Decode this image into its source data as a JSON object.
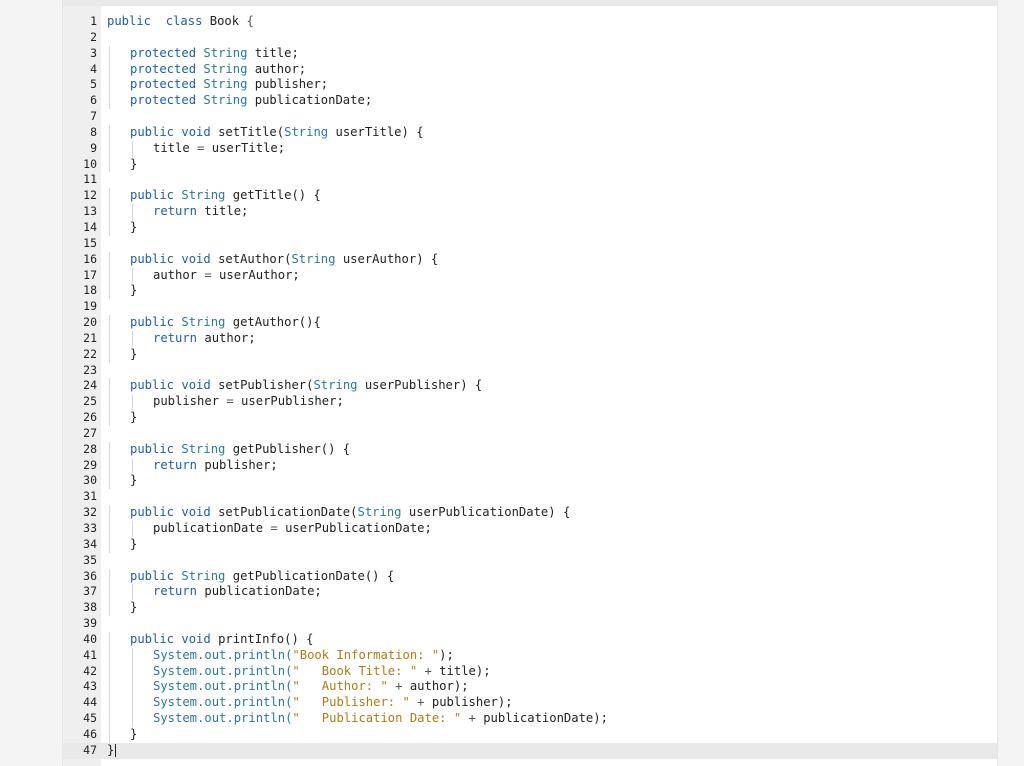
{
  "editor": {
    "lines": [
      {
        "n": "1",
        "t": [
          [
            "kw",
            "public"
          ],
          [
            "",
            "  "
          ],
          [
            "kw",
            "class"
          ],
          [
            "",
            " Book "
          ],
          [
            "op",
            "{"
          ]
        ],
        "i": 0
      },
      {
        "n": "2",
        "t": [],
        "i": 0
      },
      {
        "n": "3",
        "t": [
          [
            "kw",
            "protected"
          ],
          [
            "",
            " "
          ],
          [
            "tp",
            "String"
          ],
          [
            "",
            " title;"
          ]
        ],
        "i": 1
      },
      {
        "n": "4",
        "t": [
          [
            "kw",
            "protected"
          ],
          [
            "",
            " "
          ],
          [
            "tp",
            "String"
          ],
          [
            "",
            " author;"
          ]
        ],
        "i": 1
      },
      {
        "n": "5",
        "t": [
          [
            "kw",
            "protected"
          ],
          [
            "",
            " "
          ],
          [
            "tp",
            "String"
          ],
          [
            "",
            " publisher;"
          ]
        ],
        "i": 1
      },
      {
        "n": "6",
        "t": [
          [
            "kw",
            "protected"
          ],
          [
            "",
            " "
          ],
          [
            "tp",
            "String"
          ],
          [
            "",
            " publicationDate;"
          ]
        ],
        "i": 1
      },
      {
        "n": "7",
        "t": [],
        "i": 0
      },
      {
        "n": "8",
        "t": [
          [
            "kw",
            "public"
          ],
          [
            "",
            " "
          ],
          [
            "kw",
            "void"
          ],
          [
            "",
            " setTitle("
          ],
          [
            "tp",
            "String"
          ],
          [
            "",
            " userTitle) {"
          ]
        ],
        "i": 1
      },
      {
        "n": "9",
        "t": [
          [
            "",
            "title "
          ],
          [
            "op",
            "="
          ],
          [
            "",
            " userTitle;"
          ]
        ],
        "i": 2
      },
      {
        "n": "10",
        "t": [
          [
            "",
            "}"
          ]
        ],
        "i": 1
      },
      {
        "n": "11",
        "t": [],
        "i": 0
      },
      {
        "n": "12",
        "t": [
          [
            "kw",
            "public"
          ],
          [
            "",
            " "
          ],
          [
            "tp",
            "String"
          ],
          [
            "",
            " getTitle() {"
          ]
        ],
        "i": 1
      },
      {
        "n": "13",
        "t": [
          [
            "kw",
            "return"
          ],
          [
            "",
            " title;"
          ]
        ],
        "i": 2
      },
      {
        "n": "14",
        "t": [
          [
            "",
            "}"
          ]
        ],
        "i": 1
      },
      {
        "n": "15",
        "t": [],
        "i": 0
      },
      {
        "n": "16",
        "t": [
          [
            "kw",
            "public"
          ],
          [
            "",
            " "
          ],
          [
            "kw",
            "void"
          ],
          [
            "",
            " setAuthor("
          ],
          [
            "tp",
            "String"
          ],
          [
            "",
            " userAuthor) {"
          ]
        ],
        "i": 1
      },
      {
        "n": "17",
        "t": [
          [
            "",
            "author "
          ],
          [
            "op",
            "="
          ],
          [
            "",
            " userAuthor;"
          ]
        ],
        "i": 2
      },
      {
        "n": "18",
        "t": [
          [
            "",
            "}"
          ]
        ],
        "i": 1
      },
      {
        "n": "19",
        "t": [],
        "i": 0
      },
      {
        "n": "20",
        "t": [
          [
            "kw",
            "public"
          ],
          [
            "",
            " "
          ],
          [
            "tp",
            "String"
          ],
          [
            "",
            " getAuthor(){"
          ]
        ],
        "i": 1
      },
      {
        "n": "21",
        "t": [
          [
            "kw",
            "return"
          ],
          [
            "",
            " author;"
          ]
        ],
        "i": 2
      },
      {
        "n": "22",
        "t": [
          [
            "",
            "}"
          ]
        ],
        "i": 1
      },
      {
        "n": "23",
        "t": [],
        "i": 0
      },
      {
        "n": "24",
        "t": [
          [
            "kw",
            "public"
          ],
          [
            "",
            " "
          ],
          [
            "kw",
            "void"
          ],
          [
            "",
            " setPublisher("
          ],
          [
            "tp",
            "String"
          ],
          [
            "",
            " userPublisher) {"
          ]
        ],
        "i": 1
      },
      {
        "n": "25",
        "t": [
          [
            "",
            "publisher "
          ],
          [
            "op",
            "="
          ],
          [
            "",
            " userPublisher;"
          ]
        ],
        "i": 2
      },
      {
        "n": "26",
        "t": [
          [
            "",
            "}"
          ]
        ],
        "i": 1
      },
      {
        "n": "27",
        "t": [],
        "i": 0
      },
      {
        "n": "28",
        "t": [
          [
            "kw",
            "public"
          ],
          [
            "",
            " "
          ],
          [
            "tp",
            "String"
          ],
          [
            "",
            " getPublisher() {"
          ]
        ],
        "i": 1
      },
      {
        "n": "29",
        "t": [
          [
            "kw",
            "return"
          ],
          [
            "",
            " publisher;"
          ]
        ],
        "i": 2
      },
      {
        "n": "30",
        "t": [
          [
            "",
            "}"
          ]
        ],
        "i": 1
      },
      {
        "n": "31",
        "t": [],
        "i": 0
      },
      {
        "n": "32",
        "t": [
          [
            "kw",
            "public"
          ],
          [
            "",
            " "
          ],
          [
            "kw",
            "void"
          ],
          [
            "",
            " setPublicationDate("
          ],
          [
            "tp",
            "String"
          ],
          [
            "",
            " userPublicationDate) {"
          ]
        ],
        "i": 1
      },
      {
        "n": "33",
        "t": [
          [
            "",
            "publicationDate "
          ],
          [
            "op",
            "="
          ],
          [
            "",
            " userPublicationDate;"
          ]
        ],
        "i": 2
      },
      {
        "n": "34",
        "t": [
          [
            "",
            "}"
          ]
        ],
        "i": 1
      },
      {
        "n": "35",
        "t": [],
        "i": 0
      },
      {
        "n": "36",
        "t": [
          [
            "kw",
            "public"
          ],
          [
            "",
            " "
          ],
          [
            "tp",
            "String"
          ],
          [
            "",
            " getPublicationDate() {"
          ]
        ],
        "i": 1
      },
      {
        "n": "37",
        "t": [
          [
            "kw",
            "return"
          ],
          [
            "",
            " publicationDate;"
          ]
        ],
        "i": 2
      },
      {
        "n": "38",
        "t": [
          [
            "",
            "}"
          ]
        ],
        "i": 1
      },
      {
        "n": "39",
        "t": [],
        "i": 0
      },
      {
        "n": "40",
        "t": [
          [
            "kw",
            "public"
          ],
          [
            "",
            " "
          ],
          [
            "kw",
            "void"
          ],
          [
            "",
            " printInfo() {"
          ]
        ],
        "i": 1
      },
      {
        "n": "41",
        "t": [
          [
            "cls",
            "System.out.println("
          ],
          [
            "str",
            "\"Book Information: \""
          ],
          [
            "",
            ");"
          ]
        ],
        "i": 2
      },
      {
        "n": "42",
        "t": [
          [
            "cls",
            "System.out.println("
          ],
          [
            "str",
            "\"   Book Title: \""
          ],
          [
            "",
            " "
          ],
          [
            "op",
            "+"
          ],
          [
            "",
            " title);"
          ]
        ],
        "i": 2
      },
      {
        "n": "43",
        "t": [
          [
            "cls",
            "System.out.println("
          ],
          [
            "str",
            "\"   Author: \""
          ],
          [
            "",
            " "
          ],
          [
            "op",
            "+"
          ],
          [
            "",
            " author);"
          ]
        ],
        "i": 2
      },
      {
        "n": "44",
        "t": [
          [
            "cls",
            "System.out.println("
          ],
          [
            "str",
            "\"   Publisher: \""
          ],
          [
            "",
            " "
          ],
          [
            "op",
            "+"
          ],
          [
            "",
            " publisher);"
          ]
        ],
        "i": 2
      },
      {
        "n": "45",
        "t": [
          [
            "cls",
            "System.out.println("
          ],
          [
            "str",
            "\"   Publication Date: \""
          ],
          [
            "",
            " "
          ],
          [
            "op",
            "+"
          ],
          [
            "",
            " publicationDate);"
          ]
        ],
        "i": 2
      },
      {
        "n": "46",
        "t": [
          [
            "",
            "}"
          ]
        ],
        "i": 1
      },
      {
        "n": "47",
        "t": [
          [
            "",
            "}"
          ]
        ],
        "i": 0,
        "active": true
      }
    ]
  }
}
